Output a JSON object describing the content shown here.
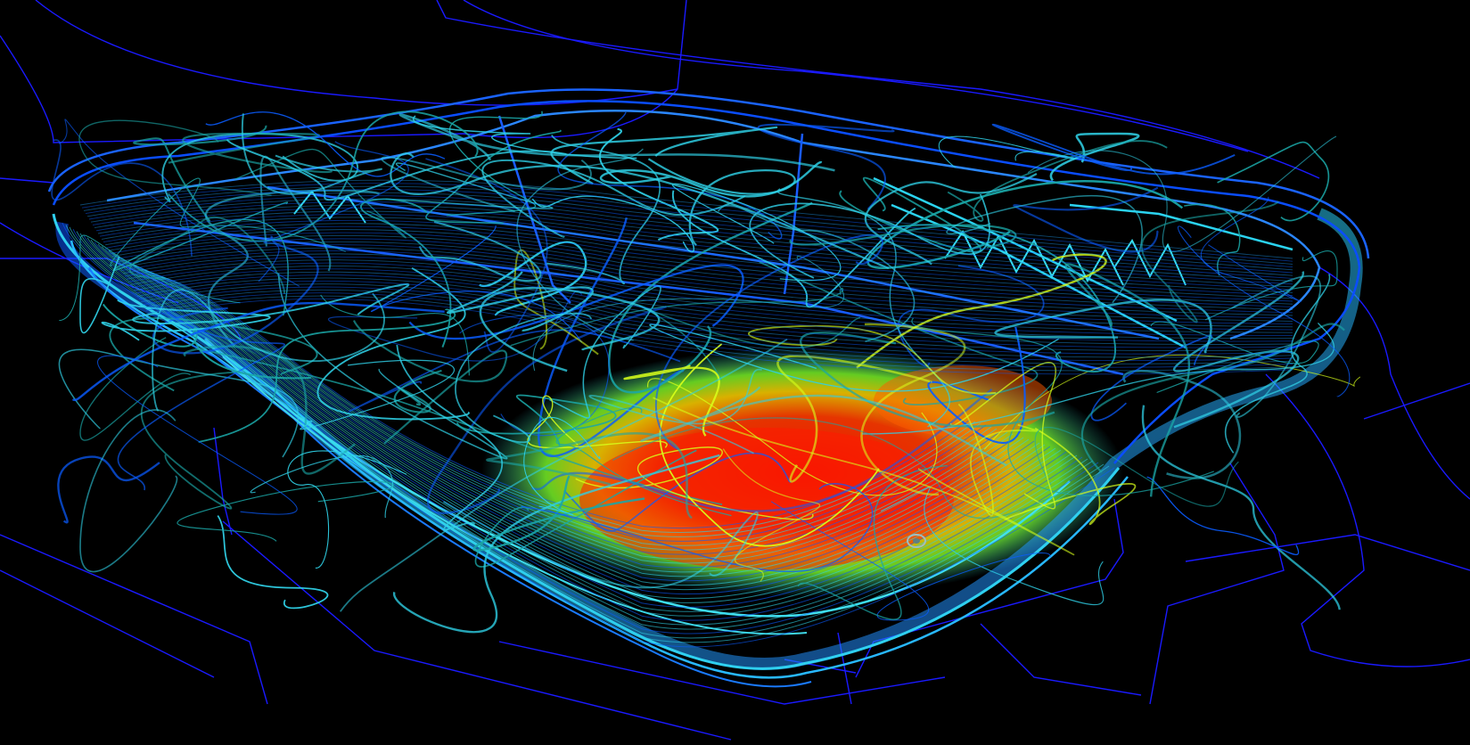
{
  "scene": {
    "subject": "stadium-airflow-streamline-visualization",
    "background_color": "#000000",
    "colors": {
      "site_lines": "#1a1aff",
      "cool_flow": "#0a5cff",
      "cyan_flow": "#2fd0e6",
      "teal_flow": "#1aa6a6",
      "warm_flow": "#d8ff1a",
      "hot_flow": "#ff1a00"
    }
  }
}
